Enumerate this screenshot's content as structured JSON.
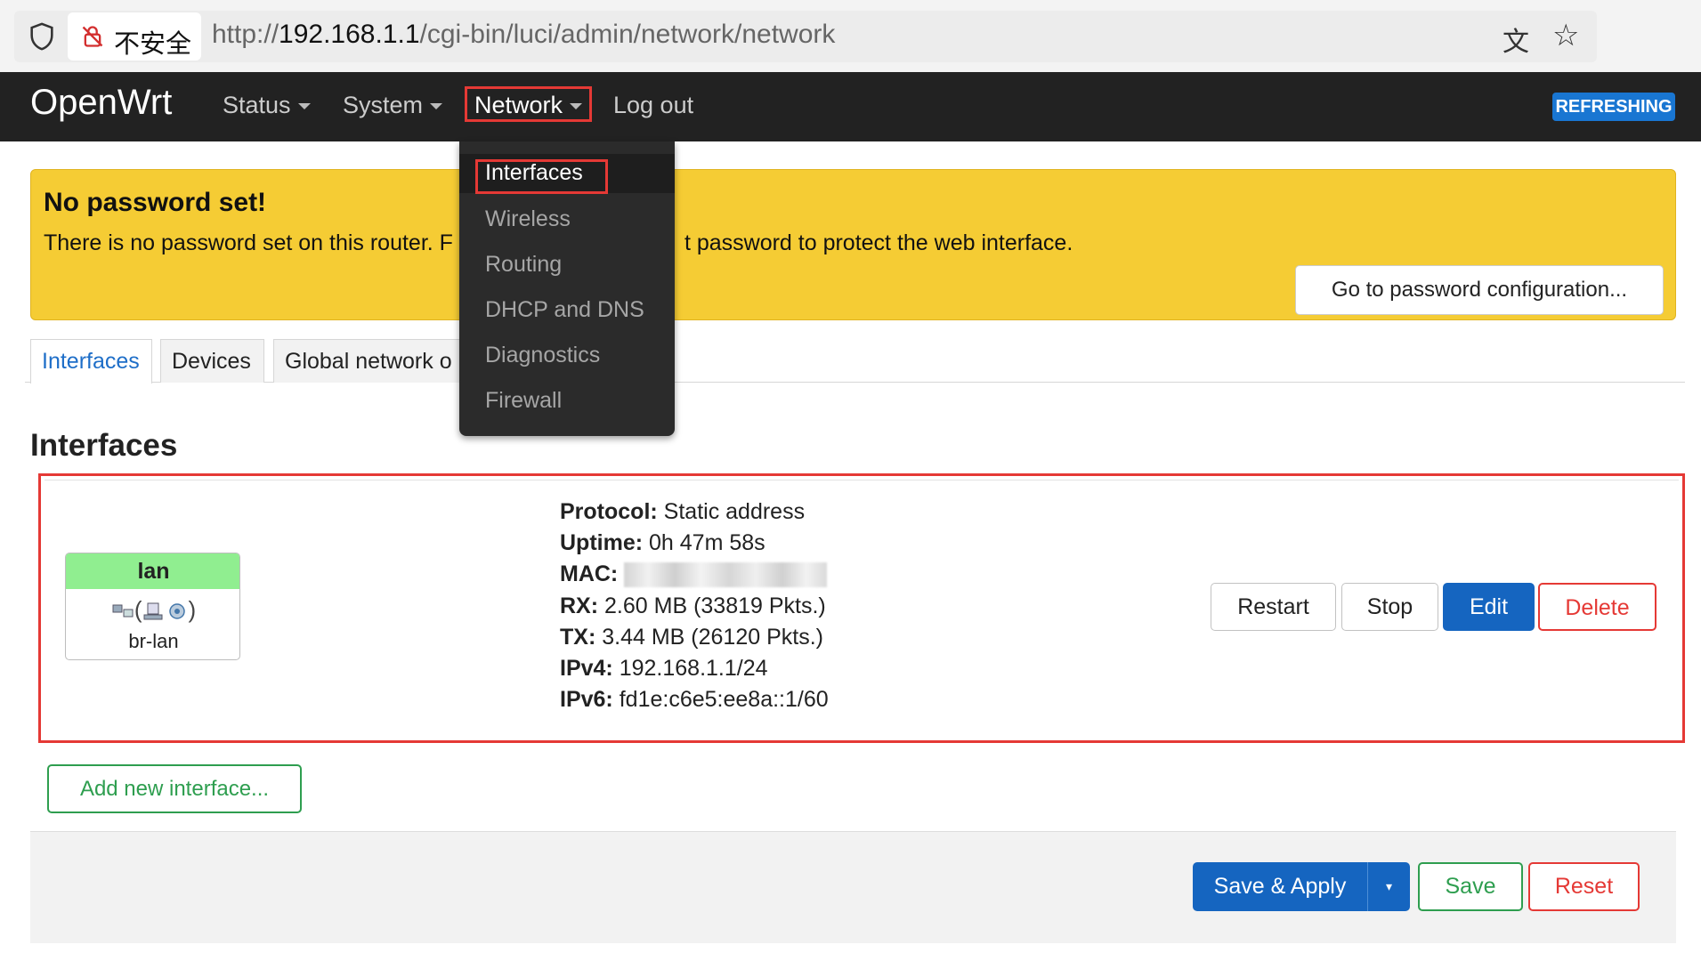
{
  "browser": {
    "security_label": "不安全",
    "url_prefix": "http://",
    "url_host": "192.168.1.1",
    "url_path": "/cgi-bin/luci/admin/network/network"
  },
  "nav": {
    "brand": "OpenWrt",
    "items": [
      {
        "label": "Status",
        "has_caret": true
      },
      {
        "label": "System",
        "has_caret": true
      },
      {
        "label": "Network",
        "has_caret": true
      },
      {
        "label": "Log out",
        "has_caret": false
      }
    ],
    "refreshing_badge": "REFRESHING"
  },
  "network_menu": {
    "items": [
      "Interfaces",
      "Wireless",
      "Routing",
      "DHCP and DNS",
      "Diagnostics",
      "Firewall"
    ],
    "active": "Interfaces"
  },
  "warning": {
    "title": "No password set!",
    "text": "There is no password set on this router. Please configure a root password to protect the web interface.",
    "visible_text_left": "There is no password set on this router. F",
    "visible_text_right": "t password to protect the web interface.",
    "button": "Go to password configuration..."
  },
  "tabs": [
    {
      "label": "Interfaces",
      "active": true
    },
    {
      "label": "Devices",
      "active": false
    },
    {
      "label": "Global network o",
      "active": false
    }
  ],
  "section_title": "Interfaces",
  "interface": {
    "name": "lan",
    "device": "br-lan",
    "header_color": "#90ee90",
    "info": [
      {
        "key": "Protocol:",
        "value": "Static address"
      },
      {
        "key": "Uptime:",
        "value": "0h 47m 58s"
      },
      {
        "key": "MAC:",
        "value": ""
      },
      {
        "key": "RX:",
        "value": "2.60 MB (33819 Pkts.)"
      },
      {
        "key": "TX:",
        "value": "3.44 MB (26120 Pkts.)"
      },
      {
        "key": "IPv4:",
        "value": "192.168.1.1/24"
      },
      {
        "key": "IPv6:",
        "value": "fd1e:c6e5:ee8a::1/60"
      }
    ],
    "actions": [
      "Restart",
      "Stop",
      "Edit",
      "Delete"
    ]
  },
  "add_interface_button": "Add new interface...",
  "footer": {
    "save_apply": "Save & Apply",
    "dropdown_caret": "▾",
    "save": "Save",
    "reset": "Reset"
  },
  "colors": {
    "nav_bg": "#222222",
    "warning_bg": "#f5cc34",
    "primary": "#1565c0",
    "success": "#2e9e4f",
    "danger": "#e53935",
    "tab_active_text": "#1e6ec8"
  }
}
